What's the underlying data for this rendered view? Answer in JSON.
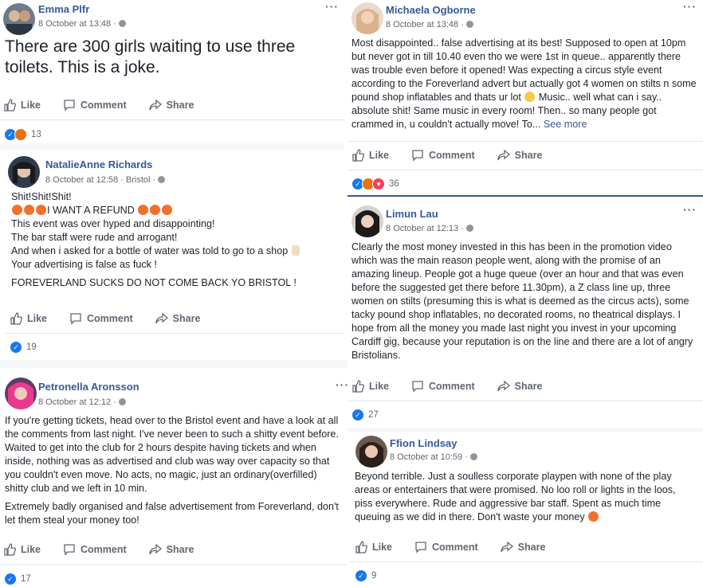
{
  "actions": {
    "like": "Like",
    "comment": "Comment",
    "share": "Share"
  },
  "posts": [
    {
      "name": "Emma Plfr",
      "meta": "8 October at 13:48 ·",
      "text": [
        "There are 300 girls waiting to use three toilets. This is a joke."
      ],
      "reaction_count": "13",
      "reaction_types": [
        "like",
        "angry"
      ]
    },
    {
      "name": "NatalieAnne Richards",
      "meta": "8 October at 12:58 · Bristol ·",
      "lines": [
        "Shit!Shit!Shit!",
        "I WANT A REFUND",
        "This event was over hyped and disappointing!",
        "The bar staff were rude and arrogant!",
        "And when i asked for a bottle of water was told to go to a shop",
        "Your advertising is false as fuck !",
        "FOREVERLAND SUCKS DO NOT COME BACK YO BRISTOL !"
      ],
      "reaction_count": "19",
      "reaction_types": [
        "like"
      ]
    },
    {
      "name": "Petronella Aronsson",
      "meta": "8 October at 12:12 ·",
      "paras": [
        "If you're getting tickets, head over to the Bristol event and have a look at all the comments from last night. I've never been to such a shitty event before. Waited to get into the club for 2 hours despite having tickets and when inside, nothing was as advertised and club was way over capacity so that you couldn't even move. No acts, no magic, just an ordinary(overfilled) shitty club and we left in 10 min.",
        "Extremely badly organised and false advertisement from Foreverland, don't let them steal your money too!"
      ],
      "reaction_count": "17",
      "reaction_types": [
        "like"
      ]
    },
    {
      "name": "Michaela Ogborne",
      "meta": "8 October at 13:48 ·",
      "text_a": "Most disappointed.. false advertising at its best! Supposed to open at 10pm but never got in till 10.40 even tho we were 1st in queue.. apparently there was trouble even before it opened! Was expecting a circus style event according to the Foreverland advert but actually got 4 women on stilts n some pound shop inflatables and thats ur lot",
      "text_b": " Music.. well what can i say.. absolute shit! Same music in every room! Then.. so many people got crammed in, u couldn't actually move! To...",
      "see_more": "See more",
      "reaction_count": "36",
      "reaction_types": [
        "like",
        "angry",
        "love"
      ]
    },
    {
      "name": "Limun Lau",
      "meta": "8 October at 12:13 ·",
      "text": "Clearly the most money invested in this has been in the promotion video which was the main reason people went, along with the promise of an amazing lineup. People got a huge queue (over an hour and that was even before the suggested get there before 11.30pm), a Z class line up, three women on stilts (presuming this is what is deemed as the circus acts), some tacky pound shop inflatables, no decorated rooms, no theatrical displays. I hope from all the money you made last night you invest in your upcoming Cardiff gig, because your reputation is on the line and there are a lot of angry Bristolians.",
      "reaction_count": "27",
      "reaction_types": [
        "like"
      ]
    },
    {
      "name": "Ffion Lindsay",
      "meta": "8 October at 10:59 ·",
      "text": "Beyond terrible. Just a soulless corporate playpen with none of the play areas or entertainers that were promised. No loo roll or lights in the loos, piss everywhere. Rude and aggressive bar staff. Spent as much time queuing as we did in there. Don't waste your money",
      "reaction_count": "9",
      "reaction_types": [
        "like"
      ]
    }
  ]
}
